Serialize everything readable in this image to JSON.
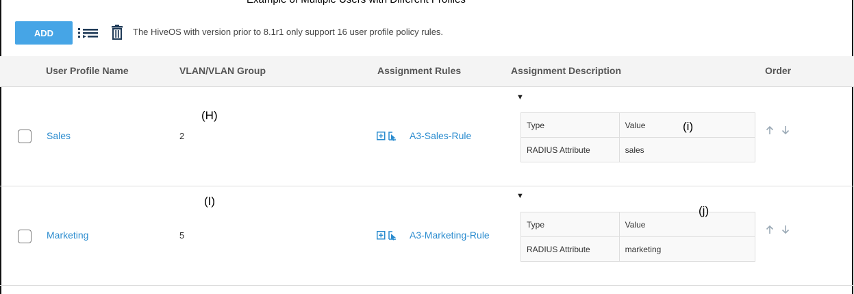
{
  "caption": "Example of Multiple Users with Different Profiles",
  "toolbar": {
    "add_label": "ADD",
    "notice": "The HiveOS with version prior to 8.1r1 only support 16 user profile policy rules.",
    "icons": [
      "list-reorder-icon",
      "trash-icon"
    ]
  },
  "table": {
    "headers": {
      "name": "User Profile Name",
      "vlan": "VLAN/VLAN Group",
      "rules": "Assignment Rules",
      "description": "Assignment Description",
      "order": "Order"
    },
    "rows": [
      {
        "name": "Sales",
        "vlan": "2",
        "rule": "A3-Sales-Rule",
        "marker_left": "(H)",
        "marker_right": "(i)",
        "desc": {
          "type_header": "Type",
          "value_header": "Value",
          "type": "RADIUS Attribute",
          "value": "sales"
        }
      },
      {
        "name": "Marketing",
        "vlan": "5",
        "rule": "A3-Marketing-Rule",
        "marker_left": "(I)",
        "marker_right": "(j)",
        "desc": {
          "type_header": "Type",
          "value_header": "Value",
          "type": "RADIUS Attribute",
          "value": "marketing"
        }
      }
    ]
  },
  "colors": {
    "accent": "#46a5e6",
    "link": "#2b8ccf",
    "header_bg": "#f4f4f4",
    "order_arrows": "#9aa9b5"
  }
}
